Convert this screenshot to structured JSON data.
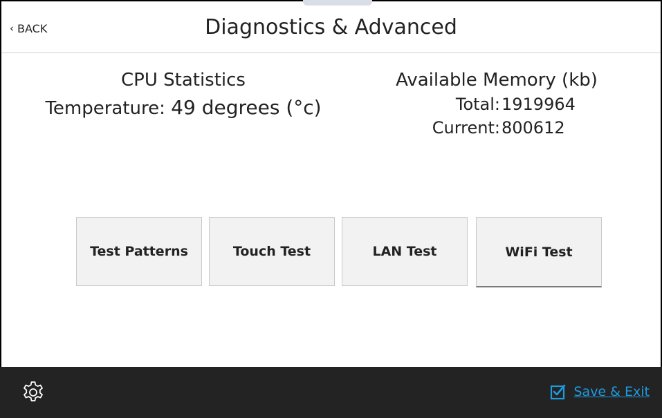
{
  "header": {
    "back_label": "BACK",
    "title": "Diagnostics & Advanced"
  },
  "cpu": {
    "heading": "CPU Statistics",
    "temp_label": "Temperature:",
    "temp_value": "49 degrees (°c)"
  },
  "memory": {
    "heading": "Available Memory (kb)",
    "total_label": "Total:",
    "total_value": "1919964",
    "current_label": "Current:",
    "current_value": "800612"
  },
  "tests": {
    "buttons": [
      {
        "label": "Test Patterns"
      },
      {
        "label": "Touch Test"
      },
      {
        "label": "LAN Test"
      },
      {
        "label": "WiFi Test"
      }
    ]
  },
  "footer": {
    "settings_icon": "gear-icon",
    "save_label": "Save & Exit",
    "save_icon": "checkbox-checked-icon"
  },
  "colors": {
    "accent": "#1e9ae0",
    "footer_bg": "#232323",
    "button_bg": "#f2f2f2"
  }
}
